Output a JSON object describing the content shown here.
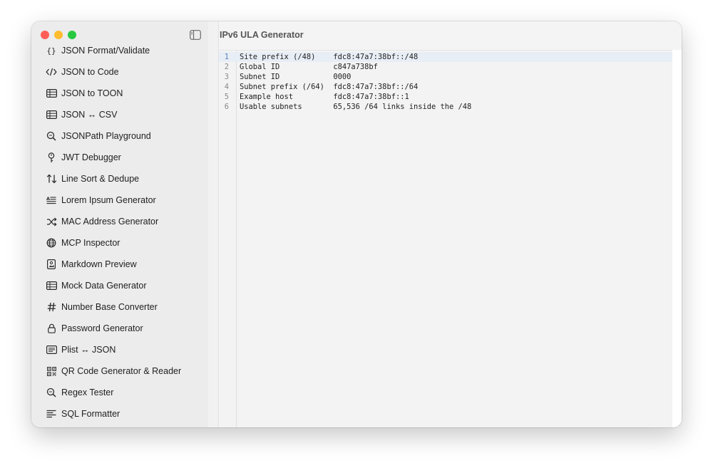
{
  "window": {
    "title": "IPv6 ULA Generator"
  },
  "sidebar": {
    "items": [
      {
        "label": "JSON Format/Validate",
        "icon": "braces-icon"
      },
      {
        "label": "JSON to Code",
        "icon": "code-icon"
      },
      {
        "label": "JSON to TOON",
        "icon": "table-icon"
      },
      {
        "label": "JSON ↔ CSV",
        "icon": "table-icon"
      },
      {
        "label": "JSONPath Playground",
        "icon": "magnifier-icon"
      },
      {
        "label": "JWT Debugger",
        "icon": "key-icon"
      },
      {
        "label": "Line Sort & Dedupe",
        "icon": "sort-arrows-icon"
      },
      {
        "label": "Lorem Ipsum Generator",
        "icon": "text-lines-icon"
      },
      {
        "label": "MAC Address Generator",
        "icon": "shuffle-icon"
      },
      {
        "label": "MCP Inspector",
        "icon": "globe-icon"
      },
      {
        "label": "Markdown Preview",
        "icon": "document-image-icon"
      },
      {
        "label": "Mock Data Generator",
        "icon": "table-icon"
      },
      {
        "label": "Number Base Converter",
        "icon": "hash-icon"
      },
      {
        "label": "Password Generator",
        "icon": "lock-icon"
      },
      {
        "label": "Plist ↔ JSON",
        "icon": "list-box-icon"
      },
      {
        "label": "QR Code Generator & Reader",
        "icon": "qr-code-icon"
      },
      {
        "label": "Regex Tester",
        "icon": "magnifier-icon"
      },
      {
        "label": "SQL Formatter",
        "icon": "text-align-icon"
      }
    ]
  },
  "editor": {
    "lines": [
      {
        "num": "1",
        "text": "Site prefix (/48)    fdc8:47a7:38bf::/48"
      },
      {
        "num": "2",
        "text": "Global ID            c847a738bf"
      },
      {
        "num": "3",
        "text": "Subnet ID            0000"
      },
      {
        "num": "4",
        "text": "Subnet prefix (/64)  fdc8:47a7:38bf::/64"
      },
      {
        "num": "5",
        "text": "Example host         fdc8:47a7:38bf::1"
      },
      {
        "num": "6",
        "text": "Usable subnets       65,536 /64 links inside the /48"
      }
    ]
  },
  "colors": {
    "close": "#ff5f57",
    "minimize": "#febc2e",
    "zoom": "#28c840",
    "active_line": "#e8eef6"
  }
}
